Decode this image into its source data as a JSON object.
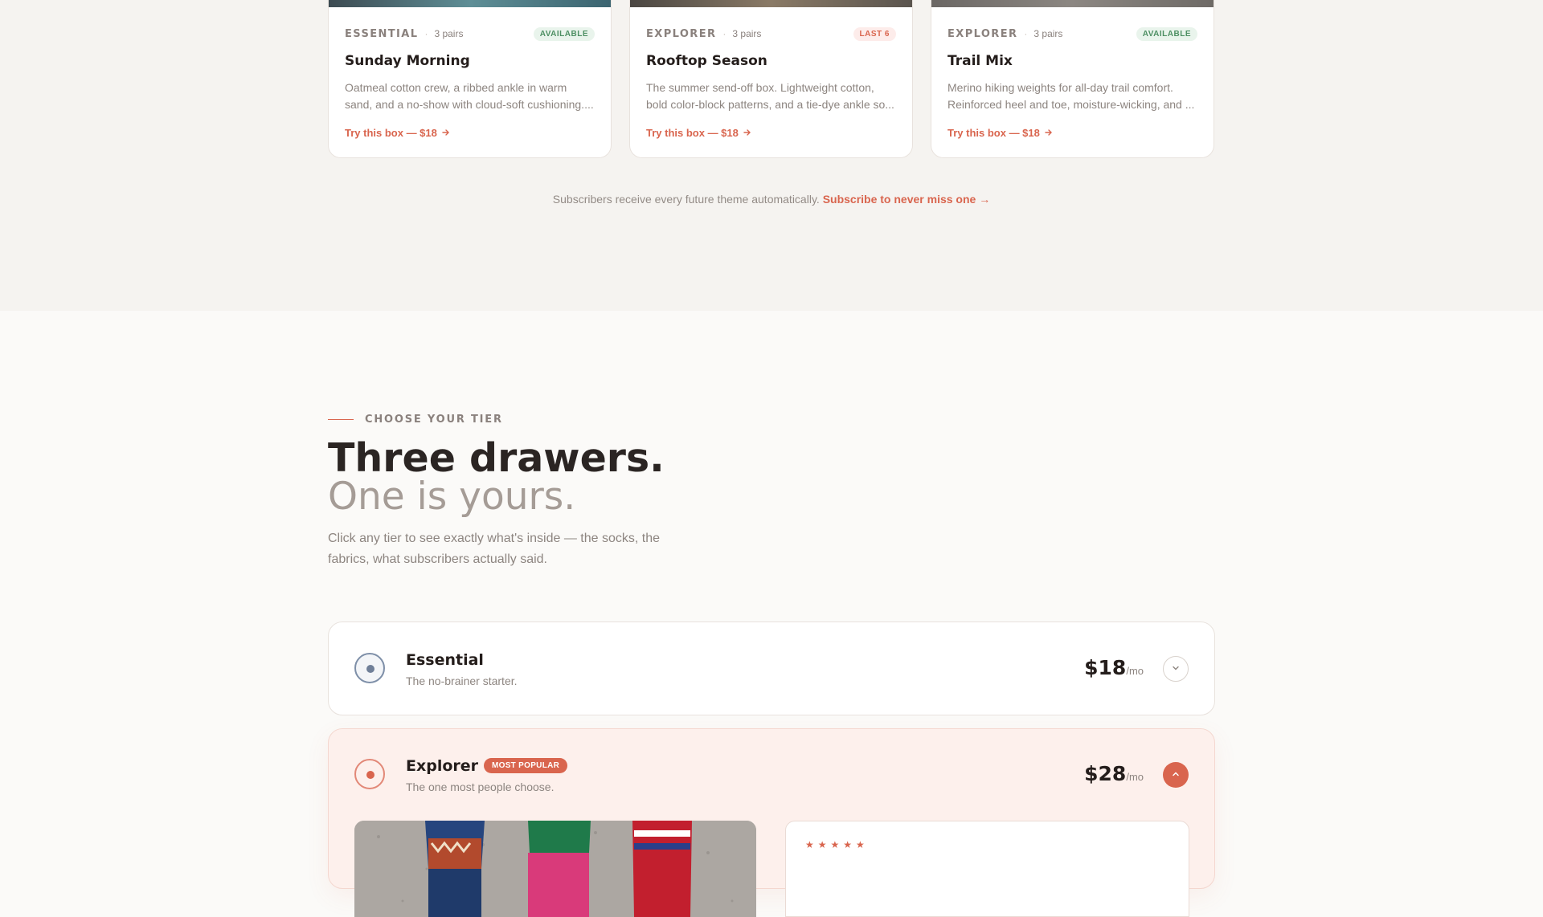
{
  "cards": [
    {
      "tier": "ESSENTIAL",
      "pairs": "3 pairs",
      "badge": "AVAILABLE",
      "title": "Sunday Morning",
      "description": "Oatmeal cotton crew, a ribbed ankle in warm sand, and a no-show with cloud-soft cushioning....",
      "cta": "Try this box — $18"
    },
    {
      "tier": "EXPLORER",
      "pairs": "3 pairs",
      "badge": "LAST 6",
      "title": "Rooftop Season",
      "description": "The summer send-off box. Lightweight cotton, bold color-block patterns, and a tie-dye ankle so...",
      "cta": "Try this box — $18"
    },
    {
      "tier": "EXPLORER",
      "pairs": "3 pairs",
      "badge": "AVAILABLE",
      "title": "Trail Mix",
      "description": "Merino hiking weights for all-day trail comfort. Reinforced heel and toe, moisture-wicking, and ...",
      "cta": "Try this box — $18"
    }
  ],
  "subscribe": {
    "text": "Subscribers receive every future theme automatically.",
    "link": "Subscribe to never miss one →"
  },
  "section": {
    "eyebrow": "CHOOSE YOUR TIER",
    "headline": "Three drawers.",
    "subheadline": "One is yours.",
    "lede": "Click any tier to see exactly what's inside — the socks, the fabrics, what subscribers actually said."
  },
  "tiers": [
    {
      "name": "Essential",
      "sub": "The no-brainer starter.",
      "price": "$18",
      "per": "/mo"
    },
    {
      "name": "Explorer",
      "badge": "MOST POPULAR",
      "sub": "The one most people choose.",
      "price": "$28",
      "per": "/mo"
    }
  ],
  "review": {
    "stars": "★★★★★"
  },
  "colors": {
    "accent": "#d9654e",
    "available": "#4d8f63",
    "background": "#fbfaf8"
  }
}
